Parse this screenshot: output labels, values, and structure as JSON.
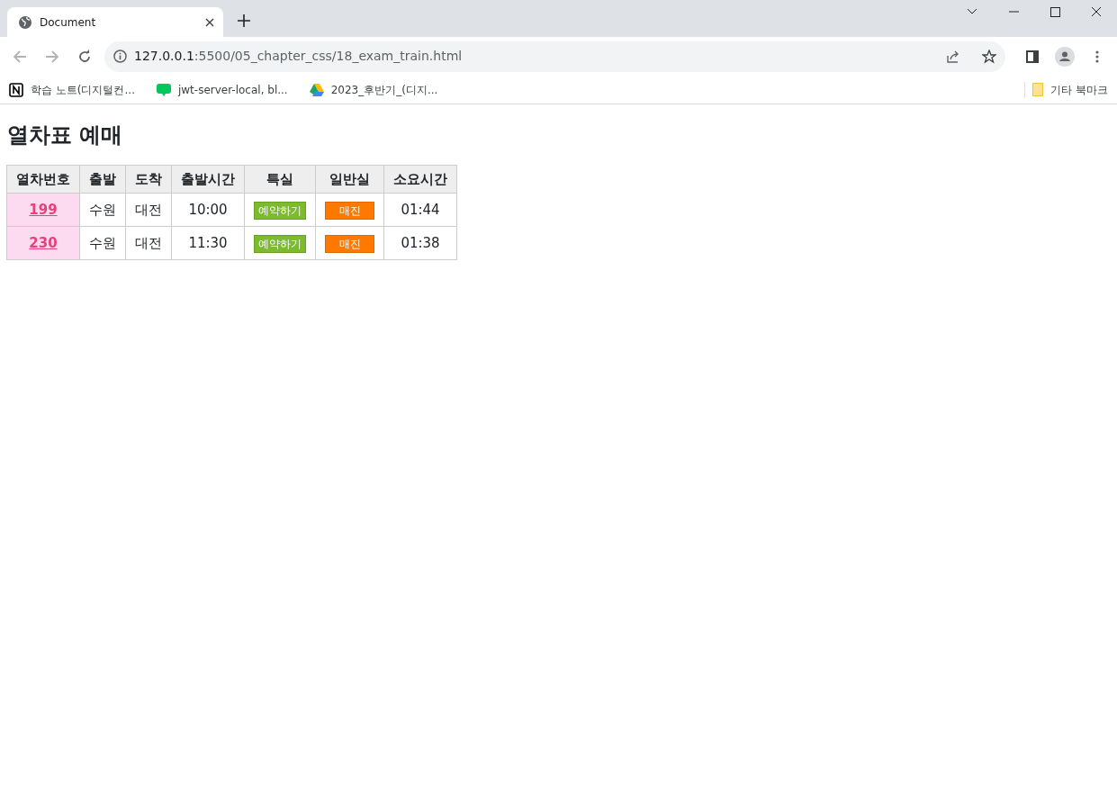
{
  "browser": {
    "tab_title": "Document",
    "url_host": "127.0.0.1",
    "url_path": ":5500/05_chapter_css/18_exam_train.html",
    "bookmarks": [
      {
        "label": "학습 노트(디지털컨...",
        "kind": "notion"
      },
      {
        "label": "jwt-server-local, bl...",
        "kind": "blog"
      },
      {
        "label": "2023_후반기_(디지...",
        "kind": "drive"
      }
    ],
    "other_bookmarks": "기타 북마크"
  },
  "page": {
    "heading": "열차표 예매",
    "table": {
      "columns": [
        "열차번호",
        "출발",
        "도착",
        "출발시간",
        "특실",
        "일반실",
        "소요시간"
      ],
      "rows": [
        {
          "train_no": "199",
          "from": "수원",
          "to": "대전",
          "departure": "10:00",
          "special": {
            "label": "예약하기",
            "kind": "available"
          },
          "general": {
            "label": "매진",
            "kind": "soldout"
          },
          "duration": "01:44"
        },
        {
          "train_no": "230",
          "from": "수원",
          "to": "대전",
          "departure": "11:30",
          "special": {
            "label": "예약하기",
            "kind": "available"
          },
          "general": {
            "label": "매진",
            "kind": "soldout"
          },
          "duration": "01:38"
        }
      ]
    }
  }
}
